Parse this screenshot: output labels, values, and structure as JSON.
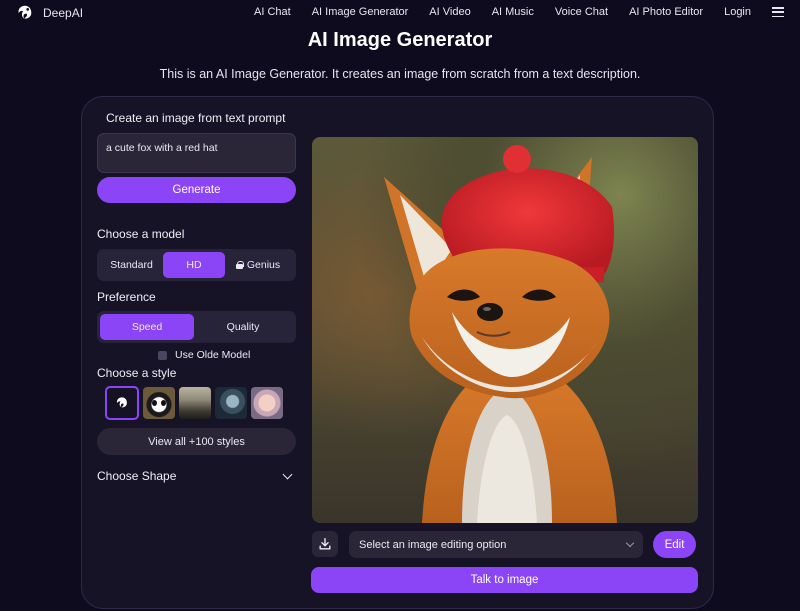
{
  "app": {
    "name": "DeepAI"
  },
  "nav": {
    "items": [
      "AI Chat",
      "AI Image Generator",
      "AI Video",
      "AI Music",
      "Voice Chat",
      "AI Photo Editor",
      "Login"
    ]
  },
  "page": {
    "title": "AI Image Generator",
    "description": "This is an AI Image Generator. It creates an image from scratch from a text description."
  },
  "form": {
    "section_title": "Create an image from text prompt",
    "prompt_value": "a cute fox with a red hat",
    "generate_label": "Generate",
    "model_label": "Choose a model",
    "models": [
      "Standard",
      "HD",
      "Genius"
    ],
    "selected_model": "HD",
    "preference_label": "Preference",
    "preferences": [
      "Speed",
      "Quality"
    ],
    "selected_preference": "Speed",
    "old_model_label": "Use Olde Model",
    "style_label": "Choose a style",
    "view_all_label": "View all +100 styles",
    "shape_label": "Choose Shape"
  },
  "result": {
    "image_subject": "fox wearing red knit hat",
    "edit_select_placeholder": "Select an image editing option",
    "edit_label": "Edit",
    "talk_label": "Talk to image"
  },
  "colors": {
    "accent": "#8b45f6",
    "background": "#0f0b1e",
    "panel": "#171327"
  }
}
